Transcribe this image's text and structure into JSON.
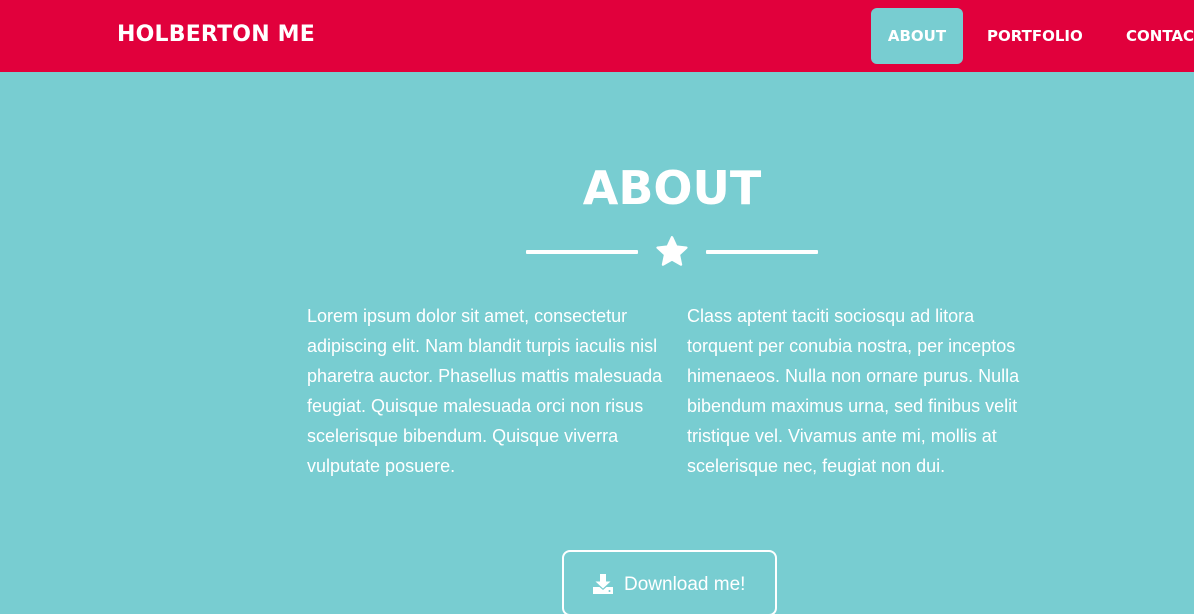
{
  "colors": {
    "navbar_bg": "#e1003c",
    "page_bg": "#78cdd1",
    "text": "#ffffff"
  },
  "navbar": {
    "brand": "HOLBERTON ME",
    "items": [
      {
        "label": "ABOUT",
        "active": true
      },
      {
        "label": "PORTFOLIO",
        "active": false
      },
      {
        "label": "CONTACT",
        "active": false
      }
    ]
  },
  "about": {
    "title": "ABOUT",
    "divider_icon": "star-icon",
    "paragraphs": [
      "Lorem ipsum dolor sit amet, consectetur adipiscing elit. Nam blandit turpis iaculis nisl pharetra auctor. Phasellus mattis malesuada feugiat. Quisque malesuada orci non risus scelerisque bibendum. Quisque viverra vulputate posuere.",
      "Class aptent taciti sociosqu ad litora torquent per conubia nostra, per inceptos himenaeos. Nulla non ornare purus. Nulla bibendum maximus urna, sed finibus velit tristique vel. Vivamus ante mi, mollis at scelerisque nec, feugiat non dui."
    ],
    "download_button": {
      "label": "Download me!",
      "icon": "download-icon"
    }
  }
}
